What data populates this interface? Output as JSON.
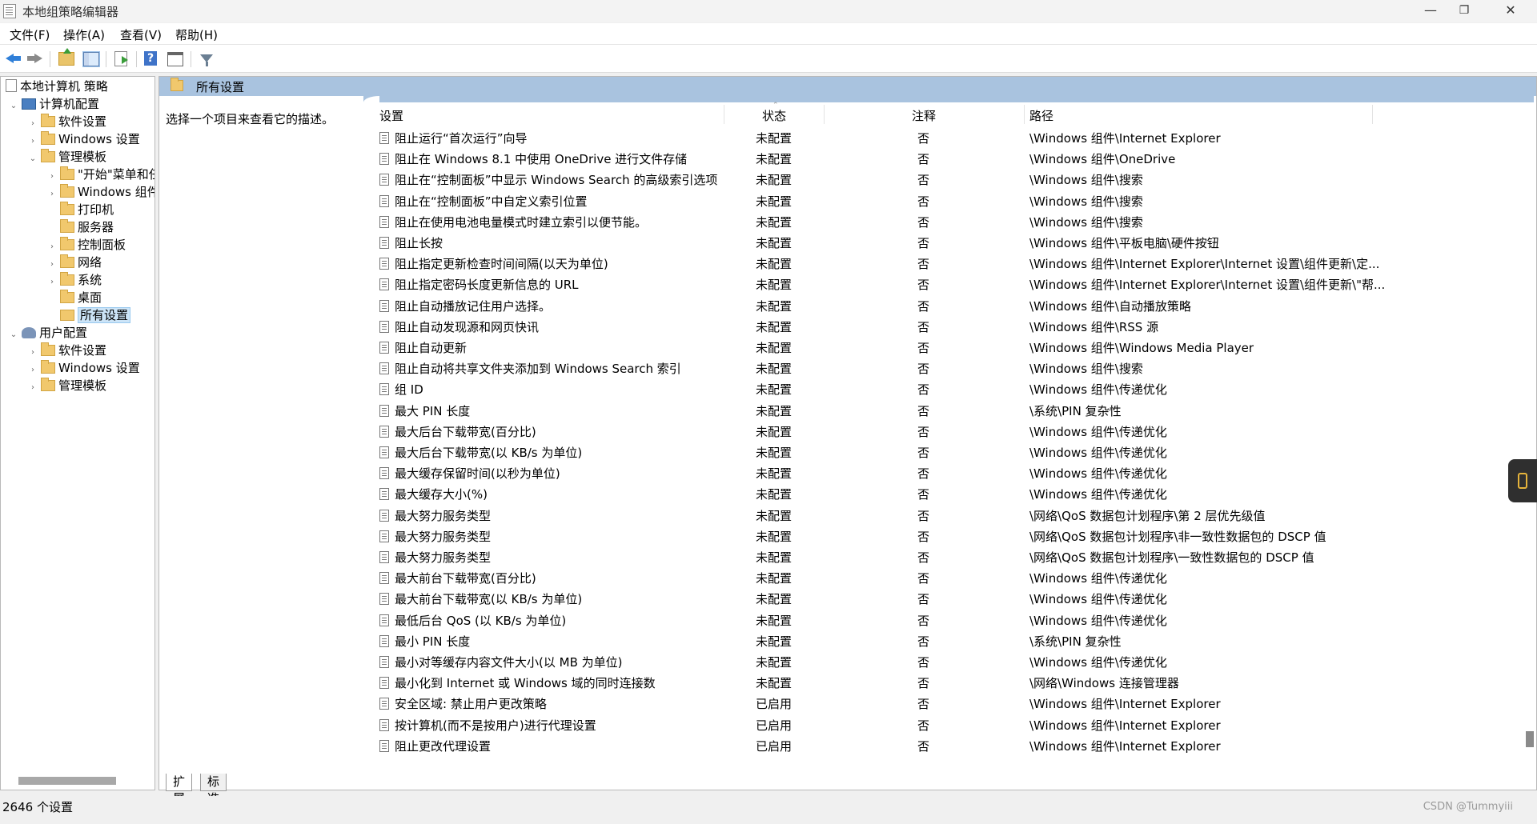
{
  "window": {
    "title": "本地组策略编辑器",
    "minimize": "—",
    "restore": "❐",
    "close": "✕"
  },
  "menu": [
    "文件(F)",
    "操作(A)",
    "查看(V)",
    "帮助(H)"
  ],
  "toolbar": {
    "help_glyph": "?"
  },
  "tree": {
    "root": "本地计算机 策略",
    "computer": "计算机配置",
    "computer_children": [
      "软件设置",
      "Windows 设置",
      "管理模板"
    ],
    "admin_children": [
      "\"开始\"菜单和任",
      "Windows 组件",
      "打印机",
      "服务器",
      "控制面板",
      "网络",
      "系统",
      "桌面",
      "所有设置"
    ],
    "user": "用户配置",
    "user_children": [
      "软件设置",
      "Windows 设置",
      "管理模板"
    ],
    "expand_glyph": "›",
    "collapse_glyph": "⌄"
  },
  "main": {
    "header_title": "所有设置",
    "description": "选择一个项目来查看它的描述。",
    "columns": {
      "setting": "设置",
      "state": "状态",
      "comment": "注释",
      "path": "路径"
    },
    "rows": [
      {
        "name": "阻止运行“首次运行”向导",
        "state": "未配置",
        "comment": "否",
        "path": "\\Windows 组件\\Internet Explorer"
      },
      {
        "name": "阻止在 Windows 8.1 中使用 OneDrive 进行文件存储",
        "state": "未配置",
        "comment": "否",
        "path": "\\Windows 组件\\OneDrive"
      },
      {
        "name": "阻止在“控制面板”中显示 Windows Search 的高级索引选项",
        "state": "未配置",
        "comment": "否",
        "path": "\\Windows 组件\\搜索"
      },
      {
        "name": "阻止在“控制面板”中自定义索引位置",
        "state": "未配置",
        "comment": "否",
        "path": "\\Windows 组件\\搜索"
      },
      {
        "name": "阻止在使用电池电量模式时建立索引以便节能。",
        "state": "未配置",
        "comment": "否",
        "path": "\\Windows 组件\\搜索"
      },
      {
        "name": "阻止长按",
        "state": "未配置",
        "comment": "否",
        "path": "\\Windows 组件\\平板电脑\\硬件按钮"
      },
      {
        "name": "阻止指定更新检查时间间隔(以天为单位)",
        "state": "未配置",
        "comment": "否",
        "path": "\\Windows 组件\\Internet Explorer\\Internet 设置\\组件更新\\定..."
      },
      {
        "name": "阻止指定密码长度更新信息的 URL",
        "state": "未配置",
        "comment": "否",
        "path": "\\Windows 组件\\Internet Explorer\\Internet 设置\\组件更新\\\"帮..."
      },
      {
        "name": "阻止自动播放记住用户选择。",
        "state": "未配置",
        "comment": "否",
        "path": "\\Windows 组件\\自动播放策略"
      },
      {
        "name": "阻止自动发现源和网页快讯",
        "state": "未配置",
        "comment": "否",
        "path": "\\Windows 组件\\RSS 源"
      },
      {
        "name": "阻止自动更新",
        "state": "未配置",
        "comment": "否",
        "path": "\\Windows 组件\\Windows Media Player"
      },
      {
        "name": "阻止自动将共享文件夹添加到 Windows Search 索引",
        "state": "未配置",
        "comment": "否",
        "path": "\\Windows 组件\\搜索"
      },
      {
        "name": "组 ID",
        "state": "未配置",
        "comment": "否",
        "path": "\\Windows 组件\\传递优化"
      },
      {
        "name": "最大 PIN 长度",
        "state": "未配置",
        "comment": "否",
        "path": "\\系统\\PIN 复杂性"
      },
      {
        "name": "最大后台下载带宽(百分比)",
        "state": "未配置",
        "comment": "否",
        "path": "\\Windows 组件\\传递优化"
      },
      {
        "name": "最大后台下载带宽(以 KB/s 为单位)",
        "state": "未配置",
        "comment": "否",
        "path": "\\Windows 组件\\传递优化"
      },
      {
        "name": "最大缓存保留时间(以秒为单位)",
        "state": "未配置",
        "comment": "否",
        "path": "\\Windows 组件\\传递优化"
      },
      {
        "name": "最大缓存大小(%)",
        "state": "未配置",
        "comment": "否",
        "path": "\\Windows 组件\\传递优化"
      },
      {
        "name": "最大努力服务类型",
        "state": "未配置",
        "comment": "否",
        "path": "\\网络\\QoS 数据包计划程序\\第 2 层优先级值"
      },
      {
        "name": "最大努力服务类型",
        "state": "未配置",
        "comment": "否",
        "path": "\\网络\\QoS 数据包计划程序\\非一致性数据包的 DSCP 值"
      },
      {
        "name": "最大努力服务类型",
        "state": "未配置",
        "comment": "否",
        "path": "\\网络\\QoS 数据包计划程序\\一致性数据包的 DSCP 值"
      },
      {
        "name": "最大前台下载带宽(百分比)",
        "state": "未配置",
        "comment": "否",
        "path": "\\Windows 组件\\传递优化"
      },
      {
        "name": "最大前台下载带宽(以 KB/s 为单位)",
        "state": "未配置",
        "comment": "否",
        "path": "\\Windows 组件\\传递优化"
      },
      {
        "name": "最低后台 QoS (以 KB/s 为单位)",
        "state": "未配置",
        "comment": "否",
        "path": "\\Windows 组件\\传递优化"
      },
      {
        "name": "最小 PIN 长度",
        "state": "未配置",
        "comment": "否",
        "path": "\\系统\\PIN 复杂性"
      },
      {
        "name": "最小对等缓存内容文件大小(以 MB 为单位)",
        "state": "未配置",
        "comment": "否",
        "path": "\\Windows 组件\\传递优化"
      },
      {
        "name": "最小化到 Internet 或 Windows 域的同时连接数",
        "state": "未配置",
        "comment": "否",
        "path": "\\网络\\Windows 连接管理器"
      },
      {
        "name": "安全区域: 禁止用户更改策略",
        "state": "已启用",
        "comment": "否",
        "path": "\\Windows 组件\\Internet Explorer"
      },
      {
        "name": "按计算机(而不是按用户)进行代理设置",
        "state": "已启用",
        "comment": "否",
        "path": "\\Windows 组件\\Internet Explorer"
      },
      {
        "name": "阻止更改代理设置",
        "state": "已启用",
        "comment": "否",
        "path": "\\Windows 组件\\Internet Explorer"
      }
    ]
  },
  "tabs": [
    "扩展",
    "标准"
  ],
  "status": {
    "count": "2646 个设置"
  },
  "watermark": "CSDN @Tummyiii"
}
